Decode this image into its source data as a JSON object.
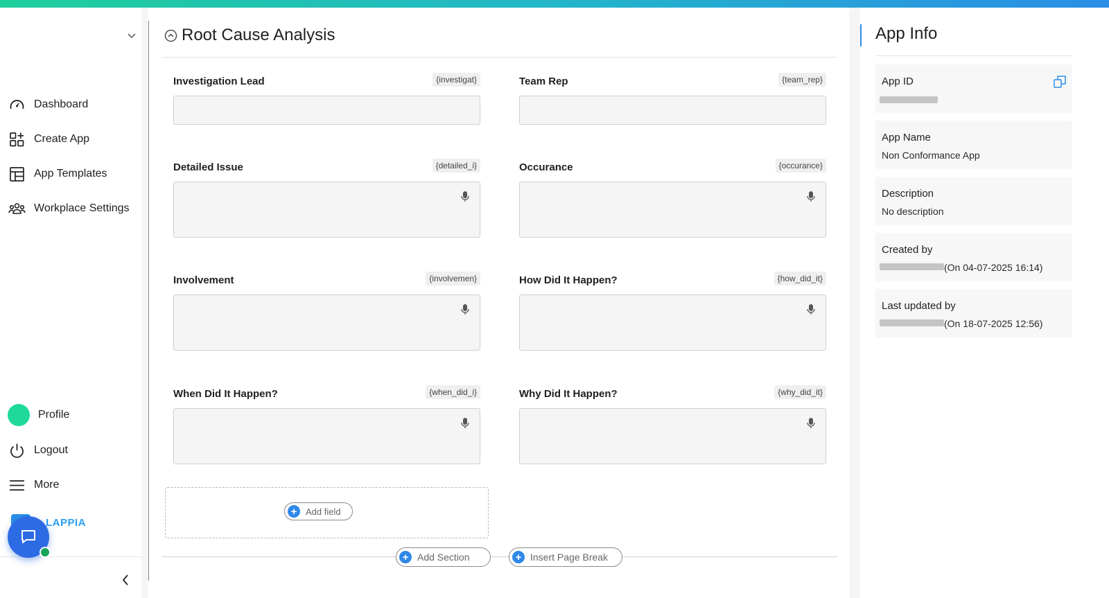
{
  "sidebar": {
    "items": [
      {
        "label": "Dashboard",
        "icon": "dashboard-icon"
      },
      {
        "label": "Create App",
        "icon": "create-app-icon"
      },
      {
        "label": "App Templates",
        "icon": "templates-icon"
      },
      {
        "label": "Workplace Settings",
        "icon": "users-icon"
      }
    ],
    "profile_label": "Profile",
    "logout_label": "Logout",
    "more_label": "More",
    "brand": "LAPPIA"
  },
  "section": {
    "title": "Root Cause Analysis",
    "fields": [
      {
        "label": "Investigation Lead",
        "var": "{investigat}"
      },
      {
        "label": "Team Rep",
        "var": "{team_rep}"
      },
      {
        "label": "Detailed Issue",
        "var": "{detailed_i}"
      },
      {
        "label": "Occurance",
        "var": "{occurance}"
      },
      {
        "label": "Involvement",
        "var": "{involvemen}"
      },
      {
        "label": "How Did It Happen?",
        "var": "{how_did_it}"
      },
      {
        "label": "When Did It Happen?",
        "var": "{when_did_i}"
      },
      {
        "label": "Why Did It Happen?",
        "var": "{why_did_it}"
      }
    ],
    "add_field_label": "Add field",
    "add_section_label": "Add Section",
    "insert_page_break_label": "Insert Page Break"
  },
  "app_info": {
    "title": "App Info",
    "app_id_label": "App ID",
    "app_name_label": "App Name",
    "app_name_value": "Non Conformance App",
    "description_label": "Description",
    "description_value": "No description",
    "created_by_label": "Created by",
    "created_on": "(On 04-07-2025 16:14)",
    "updated_by_label": "Last updated by",
    "updated_on": "(On 18-07-2025 12:56)"
  },
  "colors": {
    "accent": "#2b8ee6",
    "brand_green": "#1ed99a",
    "chat_button": "#2d6be4",
    "online_dot": "#14a45a"
  }
}
